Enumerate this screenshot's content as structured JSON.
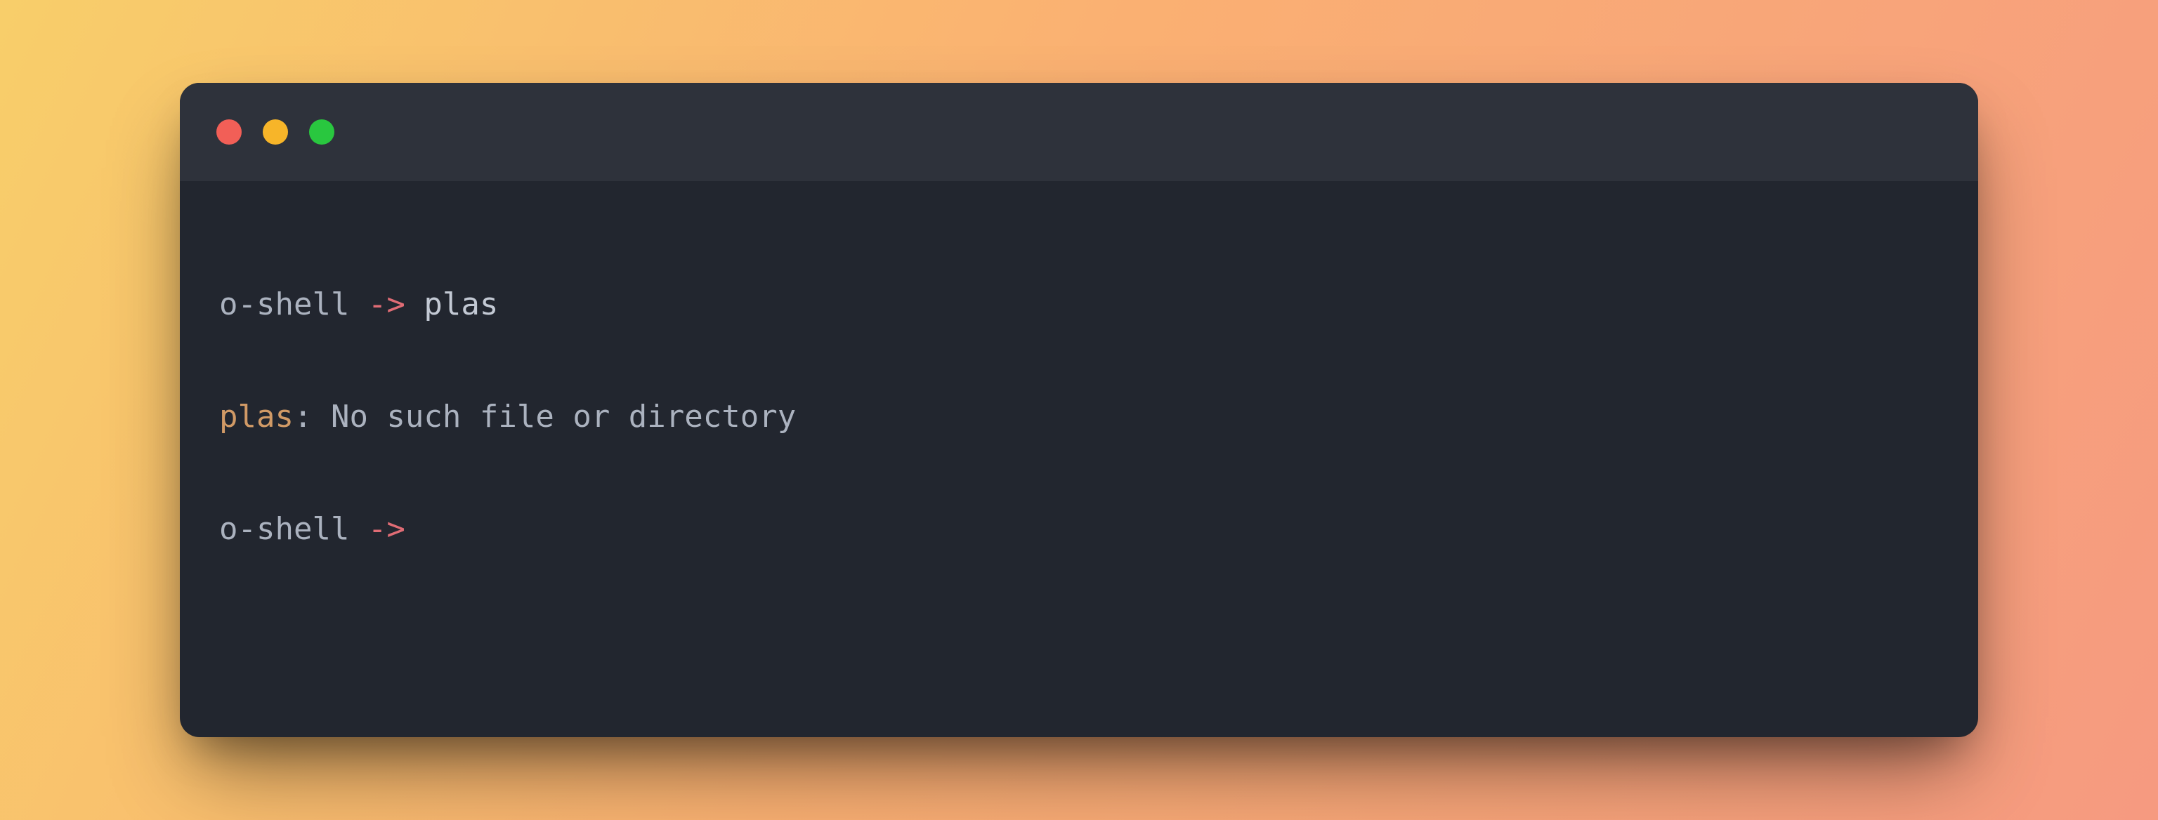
{
  "traffic_lights": {
    "close": {
      "name": "close-icon",
      "color": "#f25f57"
    },
    "minimize": {
      "name": "minimize-icon",
      "color": "#f7b529"
    },
    "maximize": {
      "name": "maximize-icon",
      "color": "#29c73f"
    }
  },
  "lines": [
    {
      "segments": [
        {
          "cls": "seg-prompt",
          "text": "o-shell "
        },
        {
          "cls": "seg-arrow",
          "text": "->"
        },
        {
          "cls": "seg-cmd",
          "text": " plas"
        }
      ]
    },
    {
      "segments": [
        {
          "cls": "seg-err",
          "text": "plas"
        },
        {
          "cls": "seg-prompt",
          "text": ": No such file or directory"
        }
      ]
    },
    {
      "segments": [
        {
          "cls": "seg-prompt",
          "text": "o-shell "
        },
        {
          "cls": "seg-arrow",
          "text": "->"
        },
        {
          "cls": "seg-cmd",
          "text": " "
        }
      ]
    }
  ]
}
